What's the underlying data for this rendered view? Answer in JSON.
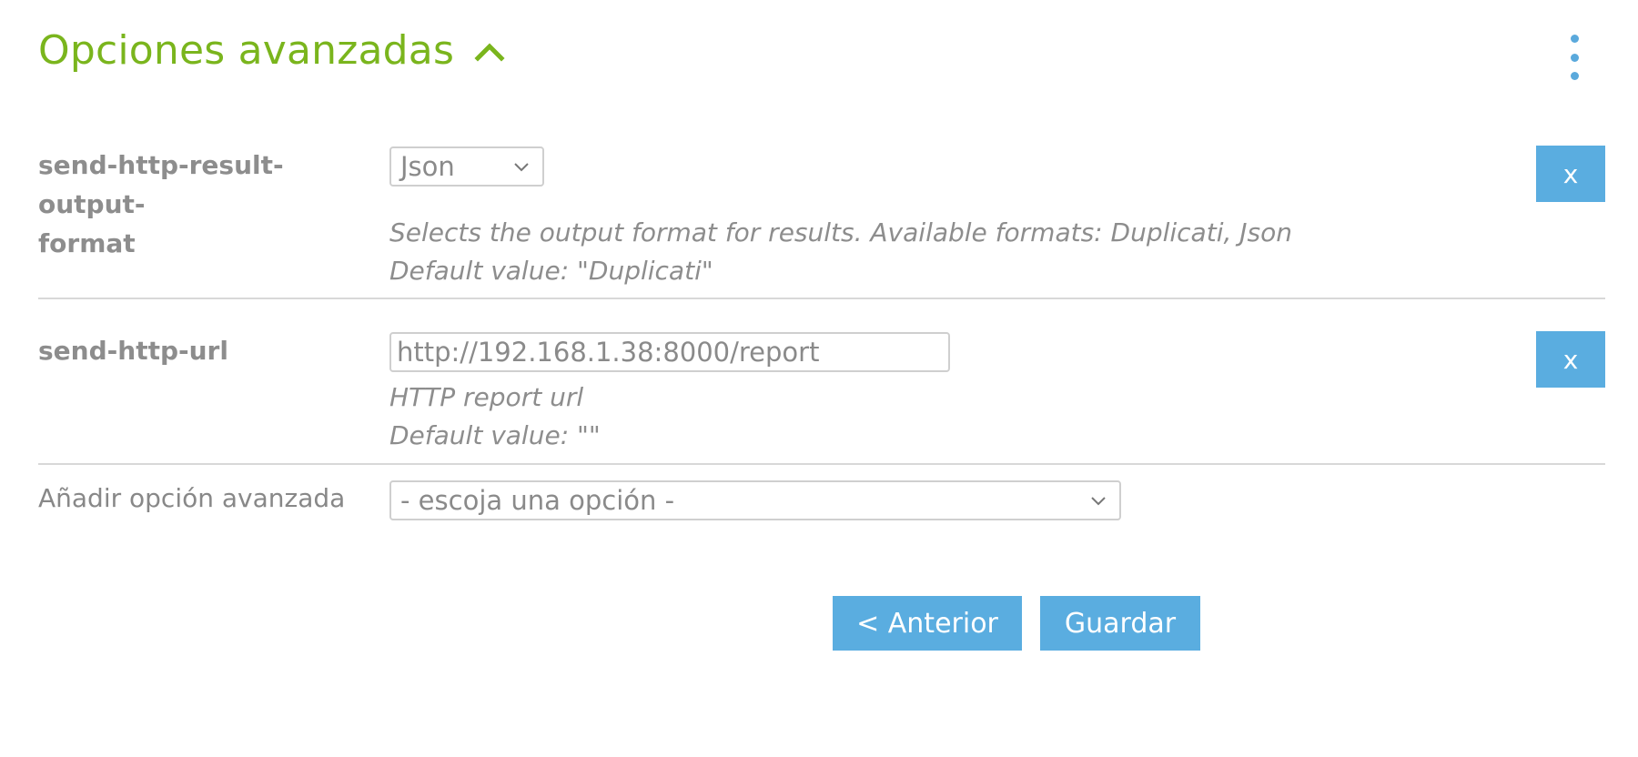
{
  "header": {
    "title": "Opciones avanzadas",
    "collapse_icon": "chevron-up-icon",
    "menu_icon": "more-vertical-icon"
  },
  "options": [
    {
      "name_line1": "send-http-result-output-",
      "name_line2": "format",
      "control": "select",
      "value": "Json",
      "description": "Selects the output format for results. Available formats: Duplicati, Json",
      "default": "Default value: \"Duplicati\"",
      "remove_label": "x"
    },
    {
      "name_line1": "send-http-url",
      "control": "text",
      "value": "http://192.168.1.38:8000/report",
      "description": "HTTP report url",
      "default": "Default value: \"\"",
      "remove_label": "x"
    }
  ],
  "add_option": {
    "label": "Añadir opción avanzada",
    "placeholder": "- escoja una opción -"
  },
  "footer": {
    "previous_label": "< Anterior",
    "save_label": "Guardar"
  },
  "colors": {
    "accent_green": "#7ab51d",
    "button_blue": "#5aade0",
    "label_gray": "#8d8d8d"
  }
}
